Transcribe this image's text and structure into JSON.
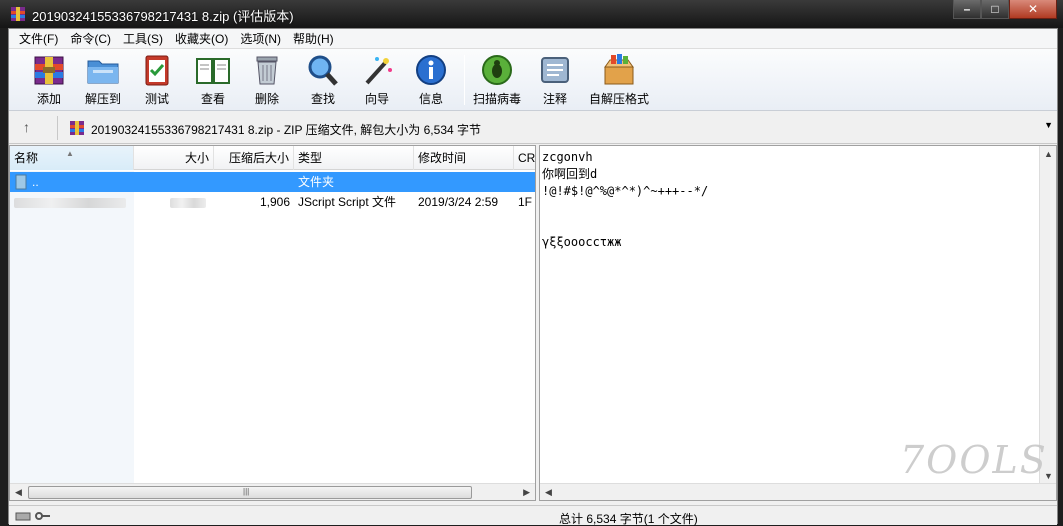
{
  "window": {
    "title": "20190324155336798217431 8.zip (评估版本)",
    "title_clean": "20190324155336798217431 8.zip (评估版本)"
  },
  "menu": [
    "文件(F)",
    "命令(C)",
    "工具(S)",
    "收藏夹(O)",
    "选项(N)",
    "帮助(H)"
  ],
  "toolbar": {
    "add": "添加",
    "extract_to": "解压到",
    "test": "测试",
    "view": "查看",
    "delete": "删除",
    "find": "查找",
    "wizard": "向导",
    "info": "信息",
    "virus_scan": "扫描病毒",
    "comment": "注释",
    "sfx": "自解压格式"
  },
  "address": {
    "text": "20190324155336798217431 8.zip - ZIP 压缩文件, 解包大小为 6,534 字节"
  },
  "file_list": {
    "columns": [
      "名称",
      "大小",
      "压缩后大小",
      "类型",
      "修改时间",
      "CR"
    ],
    "rows": [
      {
        "name": "..",
        "size": "",
        "packed": "",
        "type": "文件夹",
        "modified": "",
        "crc": ""
      },
      {
        "name": "",
        "size": "",
        "packed": "1,906",
        "type": "JScript Script 文件",
        "modified": "2019/3/24 2:59",
        "crc": "1F"
      }
    ]
  },
  "preview": {
    "lines": [
      "zcgonvh",
      "你啊回到d",
      "!@!#$!@^%@*^*)^~+++--*/",
      "",
      "",
      "γξξοοοccτжж"
    ]
  },
  "status": {
    "text": "总计 6,534 字节(1 个文件)"
  },
  "watermark": "7OOLS"
}
